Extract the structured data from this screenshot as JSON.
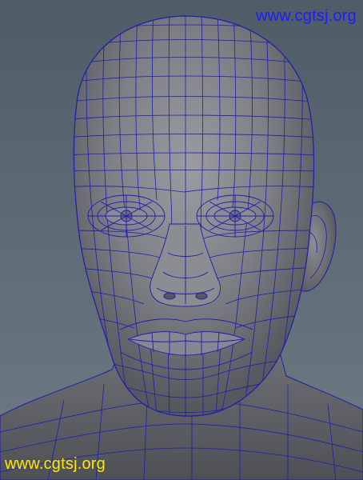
{
  "watermark_top": {
    "text": "www.cgtsj.org",
    "color": "#1c1cff"
  },
  "watermark_bottom": {
    "text": "www.cgtsj.org",
    "color": "#ffe800"
  },
  "colors": {
    "background_top": "#4f5c67",
    "background_bottom": "#6e7a84",
    "skin": "#7d7f84",
    "wire": "#1d1db0"
  },
  "viewport": {
    "subject": "head-wireframe-model",
    "shading": "smooth-shaded-with-wireframe"
  }
}
